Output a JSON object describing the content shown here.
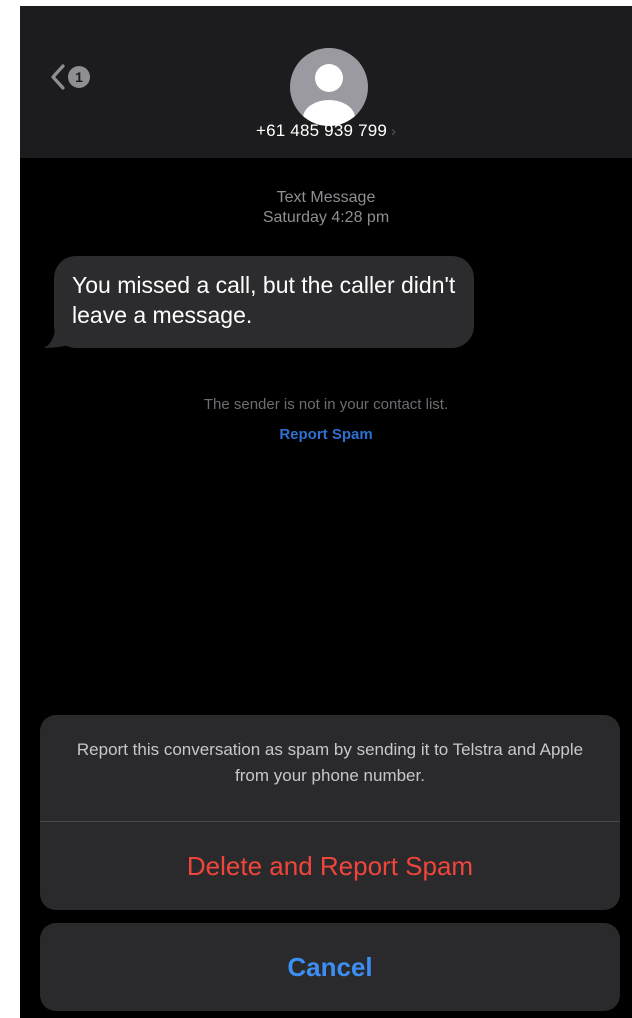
{
  "header": {
    "back_icon": "chevron-left-icon",
    "unread_count": "1",
    "avatar_icon": "person-silhouette-icon",
    "contact_number": "+61 485 939 799",
    "contact_chevron": "›"
  },
  "conversation": {
    "service_label": "Text Message",
    "timestamp": "Saturday 4:28 pm",
    "messages": [
      {
        "text": "You missed a call, but the caller didn't leave a message.",
        "direction": "incoming"
      }
    ],
    "sender_notice": "The sender is not in your contact list.",
    "report_spam_link": "Report Spam"
  },
  "action_sheet": {
    "message": "Report this conversation as spam by sending it to Telstra and Apple from your phone number.",
    "destructive_action": "Delete and Report Spam",
    "cancel_label": "Cancel"
  },
  "colors": {
    "background": "#000000",
    "header_background": "#1c1c1e",
    "bubble_background": "#2c2c2e",
    "destructive": "#f0453a",
    "link_blue": "#2f6fd0",
    "cancel_blue": "#3c8ef2"
  }
}
